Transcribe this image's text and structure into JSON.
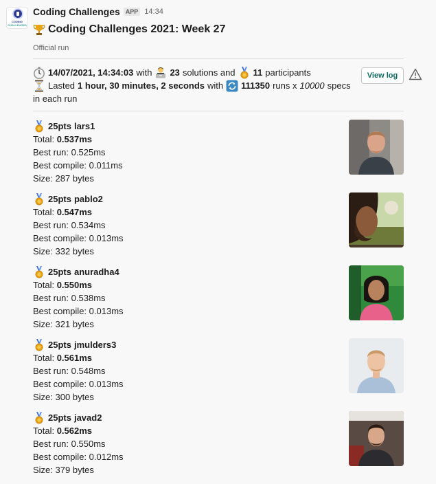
{
  "app": {
    "name": "Coding Challenges",
    "badge": "APP",
    "time": "14:34",
    "avatar_text_1": "CODING",
    "avatar_text_2": "CHALLENGES"
  },
  "message": {
    "title": "Coding Challenges 2021: Week 27",
    "title_icon": "trophy-icon",
    "subtitle": "Official run"
  },
  "run_info": {
    "datetime": "14/07/2021, 14:34:03",
    "with_text": "with",
    "solutions_count": "23",
    "solutions_text": "solutions and",
    "participants_count": "11",
    "participants_text": "participants",
    "lasted_text": "Lasted",
    "duration": "1 hour, 30 minutes, 2 seconds",
    "runs_with_text": "with",
    "runs_count": "111350",
    "runs_text": "runs x",
    "specs_count": "10000",
    "specs_text": "specs",
    "in_each_run": "in each run",
    "view_log_label": "View log"
  },
  "labels": {
    "total": "Total:",
    "best_run": "Best run:",
    "best_compile": "Best compile:",
    "size": "Size:"
  },
  "entries": [
    {
      "points": "25pts",
      "user": "lars1",
      "total": "0.537ms",
      "best_run": "0.525ms",
      "best_compile": "0.011ms",
      "size": "287 bytes"
    },
    {
      "points": "25pts",
      "user": "pablo2",
      "total": "0.547ms",
      "best_run": "0.534ms",
      "best_compile": "0.013ms",
      "size": "332 bytes"
    },
    {
      "points": "25pts",
      "user": "anuradha4",
      "total": "0.550ms",
      "best_run": "0.538ms",
      "best_compile": "0.013ms",
      "size": "321 bytes"
    },
    {
      "points": "25pts",
      "user": "jmulders3",
      "total": "0.561ms",
      "best_run": "0.548ms",
      "best_compile": "0.013ms",
      "size": "300 bytes"
    },
    {
      "points": "25pts",
      "user": "javad2",
      "total": "0.562ms",
      "best_run": "0.550ms",
      "best_compile": "0.012ms",
      "size": "379 bytes"
    }
  ],
  "colors": {
    "accent_green": "#0b6b5f",
    "gold": "#e8a317",
    "ribbon_blue": "#3b6fd6"
  }
}
